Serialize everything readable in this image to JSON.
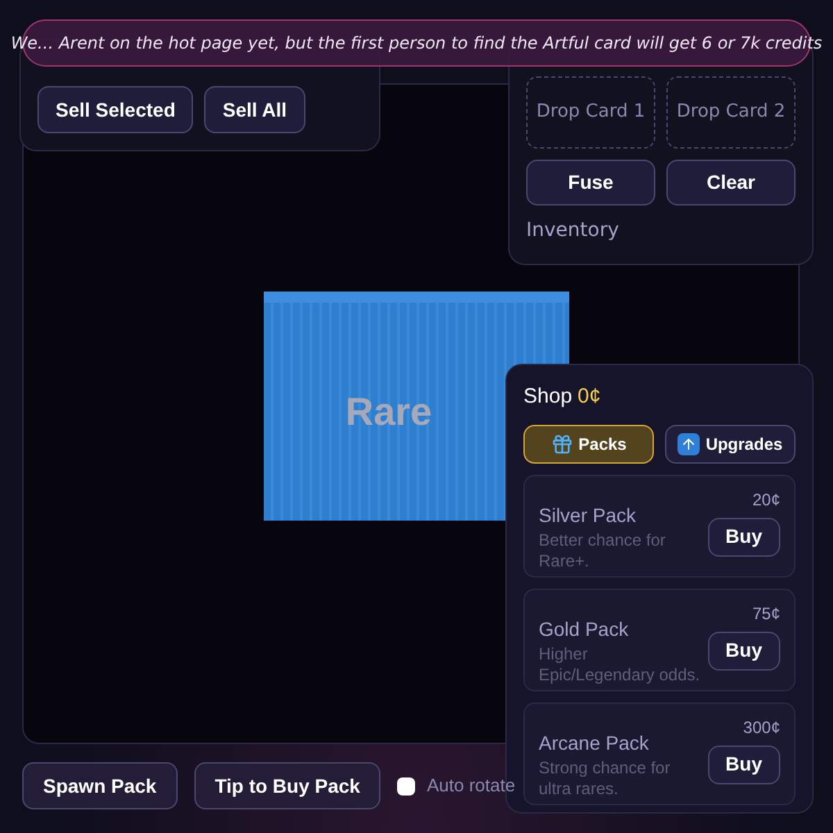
{
  "toast": {
    "message": "We... Arent on the hot page yet, but the first person to find the Artful card will get 6 or 7k credits"
  },
  "inventory_panel": {
    "buttons": [
      "Sell Selected",
      "Sell All"
    ]
  },
  "fuse_panel": {
    "slots": [
      "Drop Card 1",
      "Drop Card 2"
    ],
    "buttons": [
      "Fuse",
      "Clear"
    ],
    "footer": "Inventory"
  },
  "pack": {
    "label": "Rare"
  },
  "shop": {
    "title": "Shop",
    "credits": "0¢",
    "tabs": [
      {
        "label": "Packs",
        "kind": "gift",
        "selected": true
      },
      {
        "label": "Upgrades",
        "kind": "arrow",
        "selected": false
      }
    ],
    "items": [
      {
        "name": "Silver Pack",
        "description": "Better chance for Rare+.",
        "price": "20¢",
        "button": "Buy"
      },
      {
        "name": "Gold Pack",
        "description": "Higher Epic/Legendary odds.",
        "price": "75¢",
        "button": "Buy"
      },
      {
        "name": "Arcane Pack",
        "description": "Strong chance for ultra rares.",
        "price": "300¢",
        "button": "Buy"
      }
    ]
  },
  "controls": {
    "buttons": [
      "Spawn Pack",
      "Tip to Buy Pack"
    ],
    "auto_rotate": {
      "label": "Auto rotate",
      "checked": false
    }
  }
}
